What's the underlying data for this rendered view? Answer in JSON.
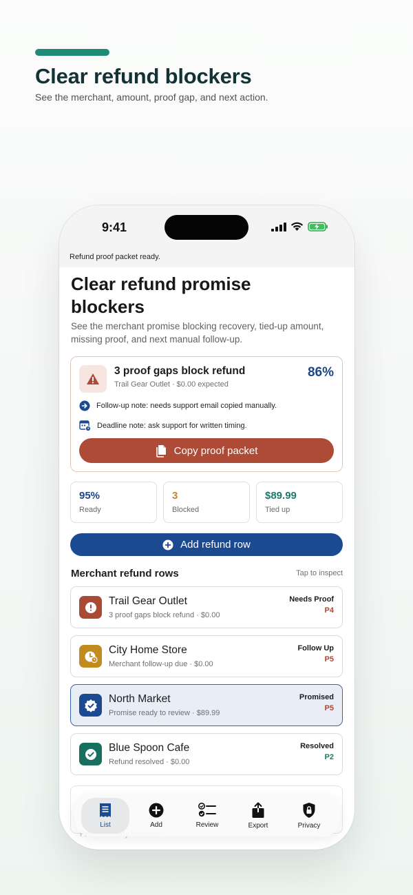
{
  "hero": {
    "title": "Clear refund blockers",
    "subtitle": "See the merchant, amount, proof gap, and next action."
  },
  "status_bar": {
    "time": "9:41"
  },
  "toast": "Refund proof packet ready.",
  "screen": {
    "title": "Clear refund promise blockers",
    "description": "See the merchant promise blocking recovery, tied-up amount, missing proof, and next manual follow-up."
  },
  "alert": {
    "icon": "warning-icon",
    "title": "3 proof gaps block refund",
    "subtitle": "Trail Gear Outlet · $0.00 expected",
    "percent": "86%",
    "notes": [
      {
        "icon": "arrow-right-circle-icon",
        "text": "Follow-up note: needs support email copied manually."
      },
      {
        "icon": "calendar-clock-icon",
        "text": "Deadline note: ask support for written timing."
      }
    ],
    "button_label": "Copy proof packet"
  },
  "stats": [
    {
      "value": "95%",
      "label": "Ready",
      "color": "#1c4585"
    },
    {
      "value": "3",
      "label": "Blocked",
      "color": "#c08a1e"
    },
    {
      "value": "$89.99",
      "label": "Tied up",
      "color": "#1a7a68"
    }
  ],
  "add_button_label": "Add refund row",
  "section": {
    "title": "Merchant refund rows",
    "hint": "Tap to inspect"
  },
  "rows": [
    {
      "name": "Trail Gear Outlet",
      "sub": "3 proof gaps block refund · $0.00",
      "status": "Needs Proof",
      "priority": "P4",
      "priority_color": "#b2452e",
      "icon": "alert-circle-icon",
      "icon_bg": "#a94a35"
    },
    {
      "name": "City Home Store",
      "sub": "Merchant follow-up due · $0.00",
      "status": "Follow Up",
      "priority": "P5",
      "priority_color": "#b2452e",
      "icon": "clock-icon",
      "icon_bg": "#c28b1f"
    },
    {
      "name": "North Market",
      "sub": "Promise ready to review · $89.99",
      "status": "Promised",
      "priority": "P5",
      "priority_color": "#b2452e",
      "icon": "verified-badge-icon",
      "icon_bg": "#1c4a91"
    },
    {
      "name": "Blue Spoon Cafe",
      "sub": "Refund resolved · $0.00",
      "status": "Resolved",
      "priority": "P2",
      "priority_color": "#1a7a68",
      "icon": "check-circle-icon",
      "icon_bg": "#17705f"
    }
  ],
  "ghost_row_text": "Promise ready to review",
  "tabs": [
    {
      "label": "List",
      "icon": "list-icon",
      "active": true
    },
    {
      "label": "Add",
      "icon": "plus-circle-icon",
      "active": false
    },
    {
      "label": "Review",
      "icon": "checklist-icon",
      "active": false
    },
    {
      "label": "Export",
      "icon": "share-icon",
      "active": false
    },
    {
      "label": "Privacy",
      "icon": "lock-shield-icon",
      "active": false
    }
  ]
}
